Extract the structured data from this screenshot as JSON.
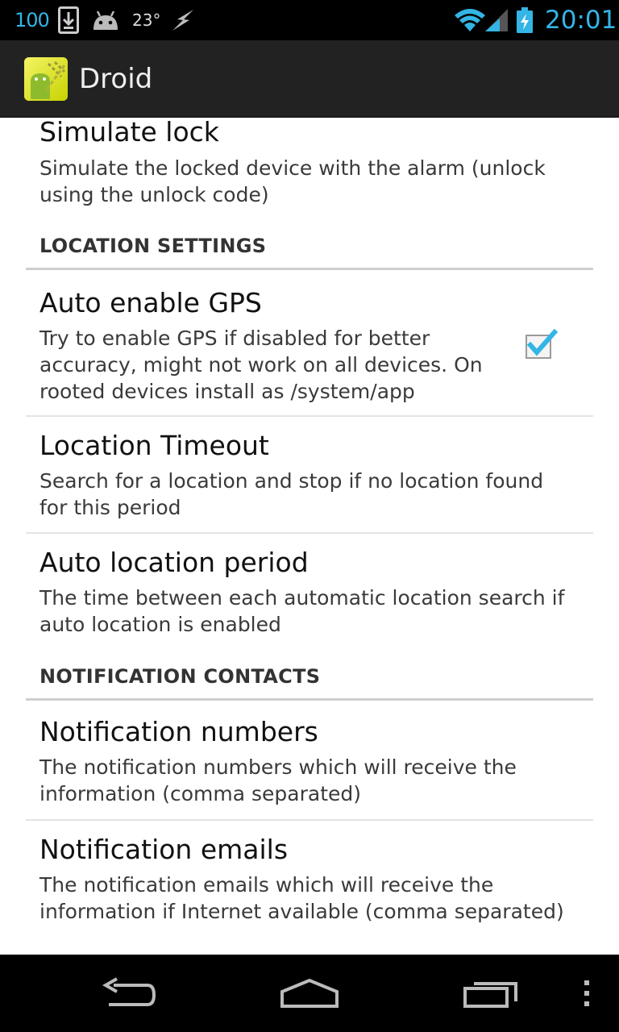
{
  "status_bar": {
    "battery_percent": "100",
    "temperature": "23°",
    "time": "20:01",
    "accent_color": "#33b5e5",
    "icons": [
      "download-icon",
      "android-icon",
      "flash-icon",
      "wifi-icon",
      "signal-icon",
      "battery-charging-icon"
    ]
  },
  "action_bar": {
    "title": "Droid",
    "icon": "app-icon"
  },
  "preferences": {
    "simulate_lock": {
      "title": "Simulate lock",
      "summary": "Simulate the locked device with the alarm (unlock using the unlock code)"
    },
    "location_category": "LOCATION SETTINGS",
    "auto_gps": {
      "title": "Auto enable GPS",
      "summary": "Try to enable GPS if disabled for better accuracy, might not work on all devices. On rooted devices install as /system/app",
      "checked": true
    },
    "location_timeout": {
      "title": "Location Timeout",
      "summary": "Search for a location and stop if no location found for this period"
    },
    "auto_location_period": {
      "title": "Auto location period",
      "summary": "The time between each automatic location search if auto location is enabled"
    },
    "notification_category": "NOTIFICATION CONTACTS",
    "notification_numbers": {
      "title": "Notification numbers",
      "summary": "The notification numbers which will receive the information (comma separated)"
    },
    "notification_emails": {
      "title": "Notification emails",
      "summary": "The notification emails which will receive the information if Internet available (comma separated)"
    }
  },
  "nav_bar": {
    "buttons": [
      "back-icon",
      "home-icon",
      "recent-apps-icon",
      "overflow-menu-icon"
    ]
  },
  "colors": {
    "check_accent": "#33b5e5",
    "action_bar_bg": "#222222",
    "content_bg": "#ffffff"
  }
}
